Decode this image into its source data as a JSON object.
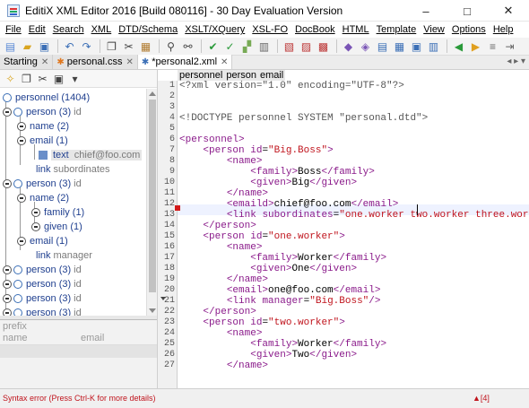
{
  "window": {
    "title": "EditiX XML Editor 2016 [Build 080116] - 30 Day Evaluation Version",
    "minimize": "–",
    "maximize": "□",
    "close": "✕"
  },
  "menu": [
    "File",
    "Edit",
    "Search",
    "XML",
    "DTD/Schema",
    "XSLT/XQuery",
    "XSL-FO",
    "DocBook",
    "HTML",
    "Template",
    "View",
    "Options",
    "Help"
  ],
  "tabs": [
    {
      "label": "Starting",
      "icon": ""
    },
    {
      "label": "personal.css",
      "icon": "✱"
    },
    {
      "label": "*personal2.xml",
      "icon": "✱"
    }
  ],
  "breadcrumb": [
    "personnel",
    "person",
    "email"
  ],
  "tree": {
    "nodes": [
      {
        "label": "personnel (1404)",
        "attr": ""
      },
      {
        "label": "person (3)",
        "attr": "id"
      },
      {
        "label": "name (2)",
        "attr": ""
      },
      {
        "label": "email (1)",
        "attr": ""
      },
      {
        "label": "text",
        "attr": "chief@foo.com"
      },
      {
        "label": "link",
        "attr": "subordinates"
      },
      {
        "label": "person (3)",
        "attr": "id"
      },
      {
        "label": "name (2)",
        "attr": ""
      },
      {
        "label": "family (1)",
        "attr": ""
      },
      {
        "label": "given (1)",
        "attr": ""
      },
      {
        "label": "email (1)",
        "attr": ""
      },
      {
        "label": "link",
        "attr": "manager"
      },
      {
        "label": "person (3)",
        "attr": "id"
      },
      {
        "label": "person (3)",
        "attr": "id"
      },
      {
        "label": "person (3)",
        "attr": "id"
      },
      {
        "label": "person (3)",
        "attr": "id"
      }
    ]
  },
  "attributes": {
    "title": "prefix",
    "col_name": "name",
    "col_email": "email"
  },
  "editor": {
    "lines": [
      "<?xml version=\"1.0\" encoding=\"UTF-8\"?>",
      "",
      "",
      "<!DOCTYPE personnel SYSTEM \"personal.dtd\">",
      "",
      "<personnel>",
      "    <person id=\"Big.Boss\">",
      "        <name>",
      "            <family>Boss</family>",
      "            <given>Big</given>",
      "        </name>",
      "        <emaild>chief@foo.com</email>",
      "        <link subordinates=\"one.worker two.worker three.worker four",
      "    </person>",
      "    <person id=\"one.worker\">",
      "        <name>",
      "            <family>Worker</family>",
      "            <given>One</given>",
      "        </name>",
      "        <email>one@foo.com</email>",
      "        <link manager=\"Big.Boss\"/>",
      "    </person>",
      "    <person id=\"two.worker\">",
      "        <name>",
      "            <family>Worker</family>",
      "            <given>Two</given>",
      "        </name>"
    ]
  },
  "status": {
    "error": "Syntax error (Press Ctrl-K for more details)",
    "errors_count": "▲[4]"
  }
}
